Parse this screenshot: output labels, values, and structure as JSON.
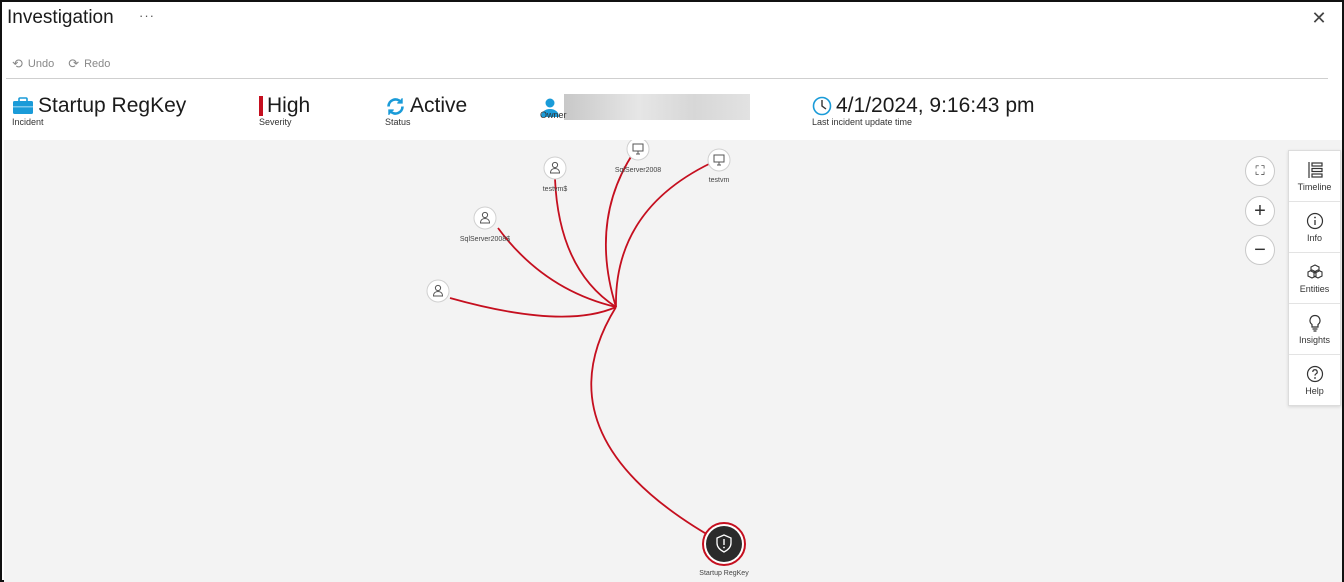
{
  "window": {
    "title": "Investigation",
    "more_label": "···",
    "close_label": "✕"
  },
  "toolbar": {
    "undo_label": "Undo",
    "redo_label": "Redo"
  },
  "summary": {
    "incident": {
      "value": "Startup RegKey",
      "label": "Incident",
      "icon": "briefcase-icon",
      "color": "#1a9bd8"
    },
    "severity": {
      "value": "High",
      "label": "Severity",
      "color": "#c50f1f"
    },
    "status": {
      "value": "Active",
      "label": "Status",
      "icon": "refresh-icon",
      "color": "#1a9bd8"
    },
    "owner": {
      "value": "",
      "label": "Owner",
      "icon": "user-icon",
      "color": "#1a9bd8"
    },
    "updated": {
      "value": "4/1/2024, 9:16:43 pm",
      "label": "Last incident update time",
      "icon": "clock-icon"
    }
  },
  "graph": {
    "edge_color": "#c50f1f",
    "nodes": [
      {
        "id": "user1",
        "label": "",
        "type": "user-icon"
      },
      {
        "id": "user2",
        "label": "SqlServer2008$",
        "type": "user-icon"
      },
      {
        "id": "user3",
        "label": "testvm$",
        "type": "user-icon"
      },
      {
        "id": "host1",
        "label": "SqlServer2008",
        "type": "computer-icon"
      },
      {
        "id": "host2",
        "label": "testvm",
        "type": "computer-icon"
      },
      {
        "id": "alert",
        "label": "Startup RegKey",
        "type": "alert-shield-icon"
      }
    ]
  },
  "zoom": {
    "fit_label": "⛶",
    "in_label": "+",
    "out_label": "−"
  },
  "side_panel": [
    {
      "label": "Timeline",
      "icon": "timeline-icon"
    },
    {
      "label": "Info",
      "icon": "info-icon"
    },
    {
      "label": "Entities",
      "icon": "cubes-icon"
    },
    {
      "label": "Insights",
      "icon": "lightbulb-icon"
    },
    {
      "label": "Help",
      "icon": "help-icon"
    }
  ]
}
